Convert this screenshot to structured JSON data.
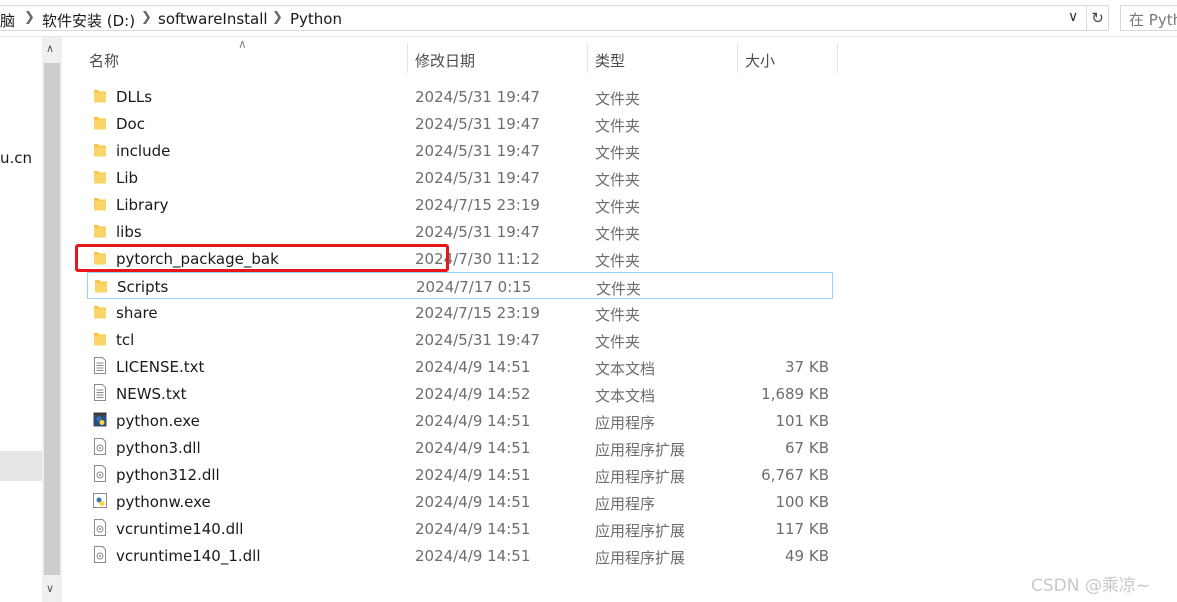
{
  "address": {
    "crumbs": [
      "脑",
      "软件安装 (D:)",
      "softwareInstall",
      "Python"
    ],
    "search_placeholder": "在 Pyth"
  },
  "nav": {
    "fragment": "u.cn"
  },
  "columns": {
    "name": "名称",
    "date": "修改日期",
    "type": "类型",
    "size": "大小"
  },
  "files": [
    {
      "name": "DLLs",
      "date": "2024/5/31 19:47",
      "type": "文件夹",
      "size": "",
      "icon": "folder-icon"
    },
    {
      "name": "Doc",
      "date": "2024/5/31 19:47",
      "type": "文件夹",
      "size": "",
      "icon": "folder-icon"
    },
    {
      "name": "include",
      "date": "2024/5/31 19:47",
      "type": "文件夹",
      "size": "",
      "icon": "folder-icon"
    },
    {
      "name": "Lib",
      "date": "2024/5/31 19:47",
      "type": "文件夹",
      "size": "",
      "icon": "folder-icon"
    },
    {
      "name": "Library",
      "date": "2024/7/15 23:19",
      "type": "文件夹",
      "size": "",
      "icon": "folder-icon"
    },
    {
      "name": "libs",
      "date": "2024/5/31 19:47",
      "type": "文件夹",
      "size": "",
      "icon": "folder-icon"
    },
    {
      "name": "pytorch_package_bak",
      "date": "2024/7/30 11:12",
      "type": "文件夹",
      "size": "",
      "icon": "folder-icon"
    },
    {
      "name": "Scripts",
      "date": "2024/7/17 0:15",
      "type": "文件夹",
      "size": "",
      "icon": "folder-icon"
    },
    {
      "name": "share",
      "date": "2024/7/15 23:19",
      "type": "文件夹",
      "size": "",
      "icon": "folder-icon"
    },
    {
      "name": "tcl",
      "date": "2024/5/31 19:47",
      "type": "文件夹",
      "size": "",
      "icon": "folder-icon"
    },
    {
      "name": "LICENSE.txt",
      "date": "2024/4/9 14:51",
      "type": "文本文档",
      "size": "37 KB",
      "icon": "text-file-icon"
    },
    {
      "name": "NEWS.txt",
      "date": "2024/4/9 14:52",
      "type": "文本文档",
      "size": "1,689 KB",
      "icon": "text-file-icon"
    },
    {
      "name": "python.exe",
      "date": "2024/4/9 14:51",
      "type": "应用程序",
      "size": "101 KB",
      "icon": "python-exe-icon"
    },
    {
      "name": "python3.dll",
      "date": "2024/4/9 14:51",
      "type": "应用程序扩展",
      "size": "67 KB",
      "icon": "dll-icon"
    },
    {
      "name": "python312.dll",
      "date": "2024/4/9 14:51",
      "type": "应用程序扩展",
      "size": "6,767 KB",
      "icon": "dll-icon"
    },
    {
      "name": "pythonw.exe",
      "date": "2024/4/9 14:51",
      "type": "应用程序",
      "size": "100 KB",
      "icon": "pythonw-exe-icon"
    },
    {
      "name": "vcruntime140.dll",
      "date": "2024/4/9 14:51",
      "type": "应用程序扩展",
      "size": "117 KB",
      "icon": "dll-icon"
    },
    {
      "name": "vcruntime140_1.dll",
      "date": "2024/4/9 14:51",
      "type": "应用程序扩展",
      "size": "49 KB",
      "icon": "dll-icon"
    }
  ],
  "hovered_row": "Scripts",
  "highlighted_row": "pytorch_package_bak",
  "colors": {
    "highlight": "#e8151b",
    "hover": "#99d1ff",
    "folder": "#f6c343"
  },
  "watermark": "CSDN @乘凉~"
}
